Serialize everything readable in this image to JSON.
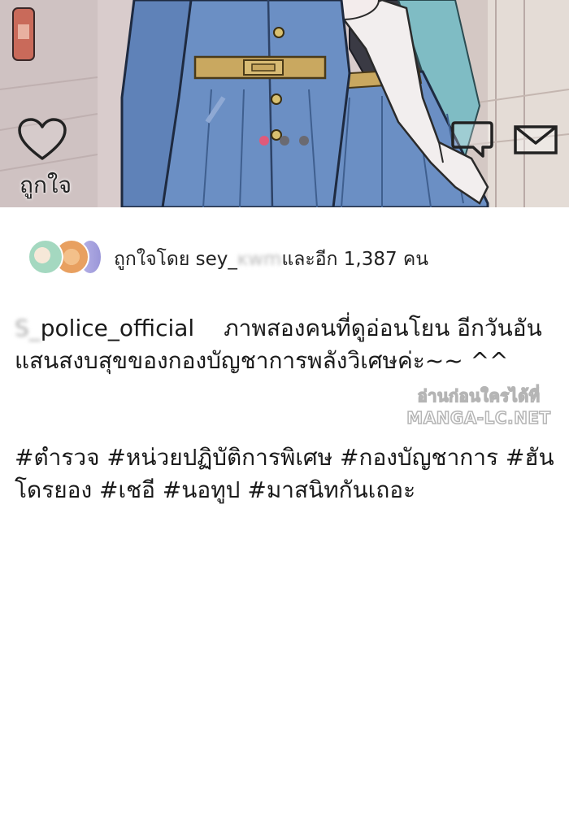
{
  "post": {
    "like_label": "ถูกใจ",
    "likes": {
      "prefix": "ถูกใจโดย sey_",
      "hidden_part": "ĸwm",
      "suffix": "และอีก 1,387 คน"
    },
    "caption": {
      "username_hidden": "S_",
      "username": "police_official",
      "text": "ภาพสองคนที่ดูอ่อนโยน อีกวันอันแสนสงบสุขของกองบัญชาการพลังวิเศษค่ะ~~ ^^"
    },
    "hashtags": "#ตำรวจ #หน่วยปฏิบัติการพิเศษ #กองบัญชาการ #ฮันโดรยอง #เชอี #นอทูป #มาสนิทกันเถอะ"
  },
  "watermark": {
    "line1": "อ่านก่อนใครได้ที่",
    "line2": "MANGA-LC.NET"
  },
  "icons": {
    "like": "heart-icon",
    "comment": "speech-bubble-icon",
    "share": "envelope-icon"
  },
  "carousel": {
    "count": 3,
    "active": 0
  },
  "colors": {
    "uniform_blue": "#6b8fc4",
    "dot_active": "#e05a7a",
    "dot_inactive": "#6a6a72"
  }
}
